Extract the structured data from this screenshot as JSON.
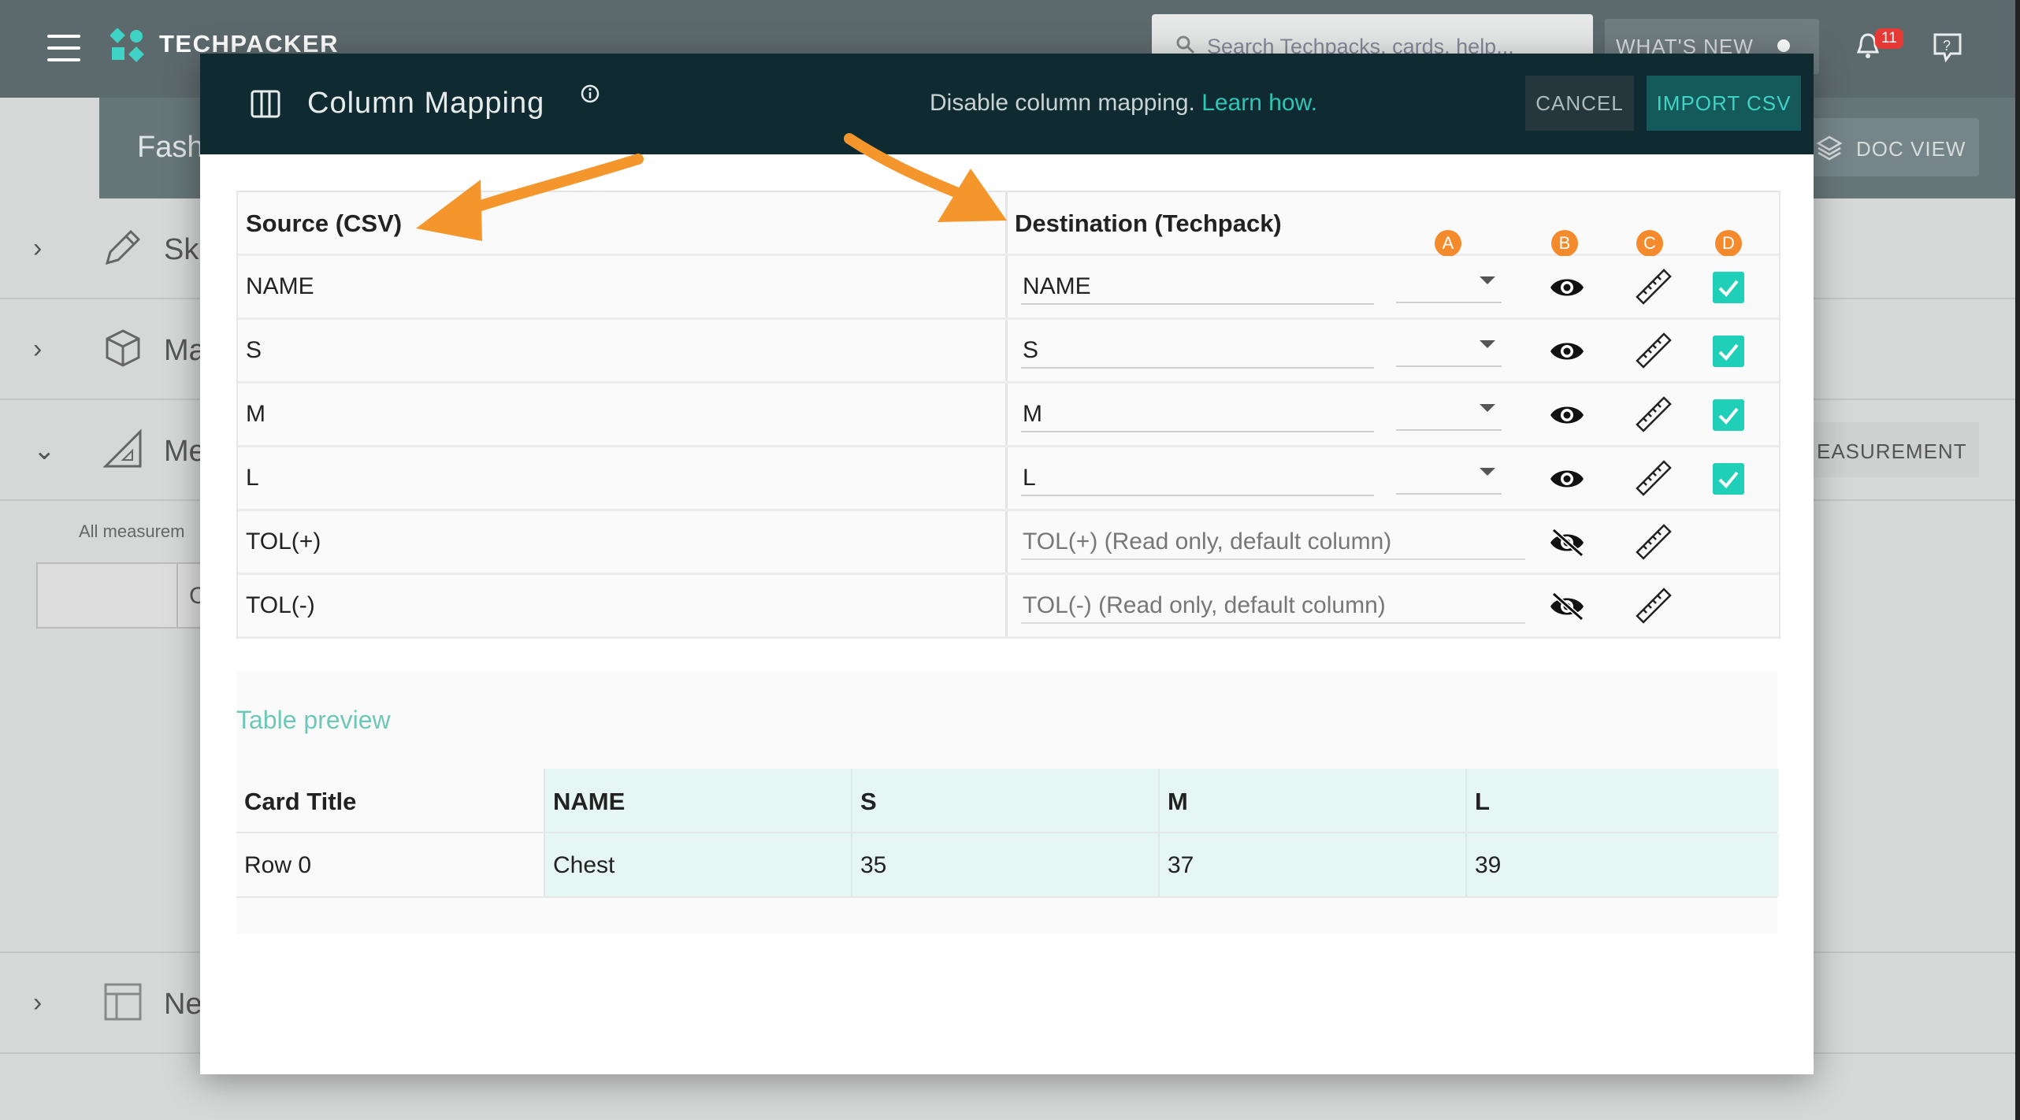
{
  "app": {
    "brand": "TECHPACKER",
    "search_placeholder": "Search Techpacks, cards, help...",
    "whats_new": "WHAT'S NEW",
    "notification_count": "11",
    "subheader_title": "Fash",
    "doc_view": "DOC VIEW",
    "sections": [
      {
        "label": "Sk",
        "chevron": "›"
      },
      {
        "label": "Ma",
        "chevron": "›"
      },
      {
        "label": "Me",
        "chevron": "⌄"
      },
      {
        "label": "Ne",
        "chevron": "›"
      }
    ],
    "measurement_button": "EASUREMENT",
    "all_measurements": "All measurem",
    "box_text": "C"
  },
  "dialog": {
    "title": "Column Mapping",
    "disable_text": "Disable column mapping.",
    "learn_link": "Learn how.",
    "cancel": "CANCEL",
    "import": "IMPORT CSV",
    "header": {
      "source": "Source (CSV)",
      "destination": "Destination (Techpack)"
    },
    "badges": [
      "A",
      "B",
      "C",
      "D"
    ],
    "rows": [
      {
        "source": "NAME",
        "destination": "NAME",
        "visible": true,
        "checked": true
      },
      {
        "source": "S",
        "destination": "S",
        "visible": true,
        "checked": true
      },
      {
        "source": "M",
        "destination": "M",
        "visible": true,
        "checked": true
      },
      {
        "source": "L",
        "destination": "L",
        "visible": true,
        "checked": true
      },
      {
        "source": "TOL(+)",
        "destination": "TOL(+) (Read only, default column)",
        "visible": false,
        "checked": false
      },
      {
        "source": "TOL(-)",
        "destination": "TOL(-) (Read only, default column)",
        "visible": false,
        "checked": false
      }
    ],
    "preview": {
      "title": "Table preview",
      "columns": [
        "Card Title",
        "NAME",
        "S",
        "M",
        "L"
      ],
      "rows": [
        [
          "Row 0",
          "Chest",
          "35",
          "37",
          "39"
        ]
      ]
    }
  },
  "colors": {
    "accent": "#1fcfb8",
    "header": "#0f2a31",
    "annotation": "#f58a2c"
  }
}
